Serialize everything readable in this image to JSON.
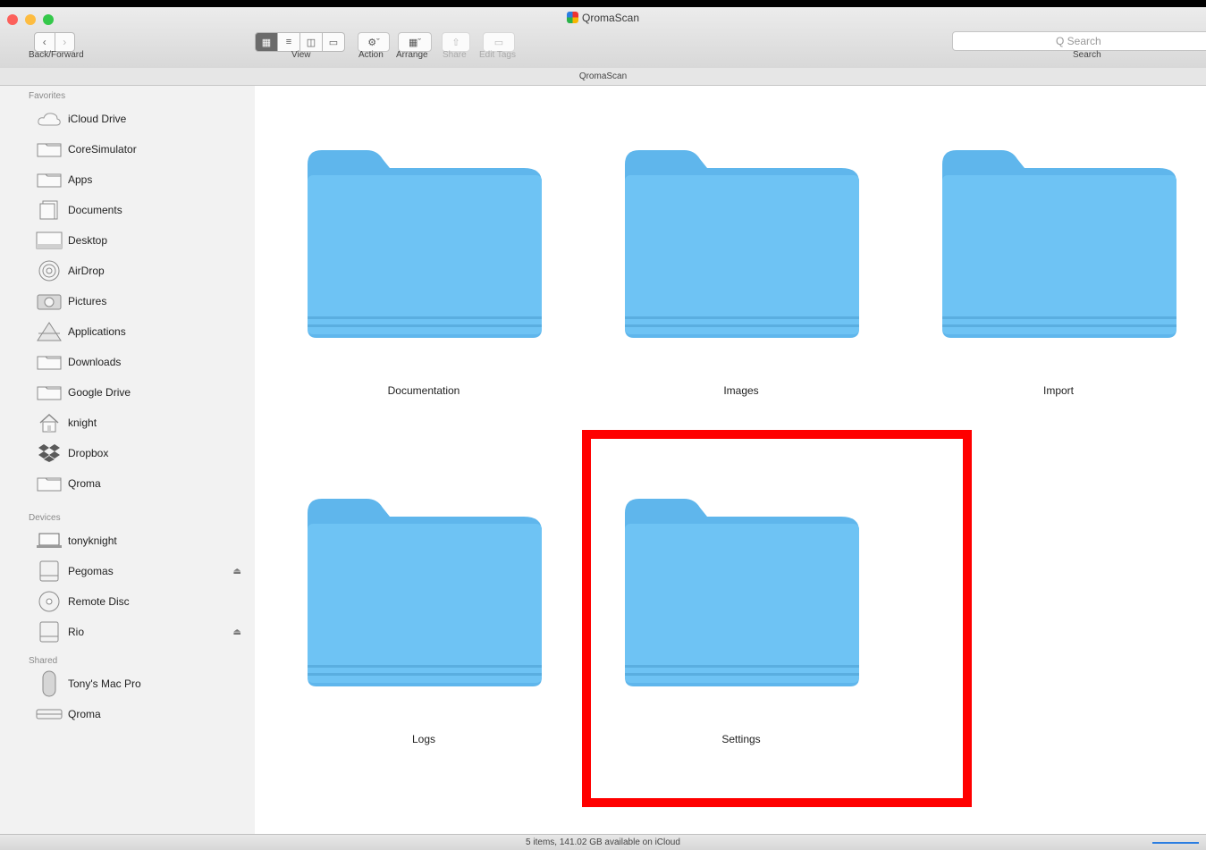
{
  "window": {
    "title": "QromaScan"
  },
  "toolbar": {
    "back_forward_label": "Back/Forward",
    "view_label": "View",
    "action_label": "Action",
    "arrange_label": "Arrange",
    "share_label": "Share",
    "edit_tags_label": "Edit Tags",
    "search_placeholder": "Q Search",
    "search_label": "Search"
  },
  "path_bar": {
    "text": "QromaScan"
  },
  "sidebar": {
    "favorites_header": "Favorites",
    "favorites": [
      {
        "label": "iCloud Drive",
        "icon": "cloud-icon"
      },
      {
        "label": "CoreSimulator",
        "icon": "folder-icon"
      },
      {
        "label": "Apps",
        "icon": "folder-icon"
      },
      {
        "label": "Documents",
        "icon": "documents-icon"
      },
      {
        "label": "Desktop",
        "icon": "desktop-icon"
      },
      {
        "label": "AirDrop",
        "icon": "airdrop-icon"
      },
      {
        "label": "Pictures",
        "icon": "camera-icon"
      },
      {
        "label": "Applications",
        "icon": "applications-icon"
      },
      {
        "label": "Downloads",
        "icon": "folder-icon"
      },
      {
        "label": "Google Drive",
        "icon": "folder-icon"
      },
      {
        "label": "knight",
        "icon": "home-icon"
      },
      {
        "label": "Dropbox",
        "icon": "dropbox-icon"
      },
      {
        "label": "Qroma",
        "icon": "folder-icon"
      }
    ],
    "devices_header": "Devices",
    "devices": [
      {
        "label": "tonyknight",
        "icon": "laptop-icon"
      },
      {
        "label": "Pegomas",
        "icon": "drive-icon"
      },
      {
        "label": "Remote Disc",
        "icon": "disc-icon"
      },
      {
        "label": "Rio",
        "icon": "drive-icon"
      }
    ],
    "shared_header": "Shared",
    "shared": [
      {
        "label": "Tony's Mac Pro",
        "icon": "mac-pro-icon"
      },
      {
        "label": "Qroma",
        "icon": "server-icon"
      }
    ]
  },
  "content": {
    "folders": [
      {
        "name": "Documentation"
      },
      {
        "name": "Images"
      },
      {
        "name": "Import"
      },
      {
        "name": "Logs"
      },
      {
        "name": "Settings"
      }
    ]
  },
  "status_bar": {
    "text": "5 items, 141.02 GB available on iCloud"
  },
  "colors": {
    "folder_blue": "#6ec3f4",
    "highlight_red": "#ff0000"
  }
}
